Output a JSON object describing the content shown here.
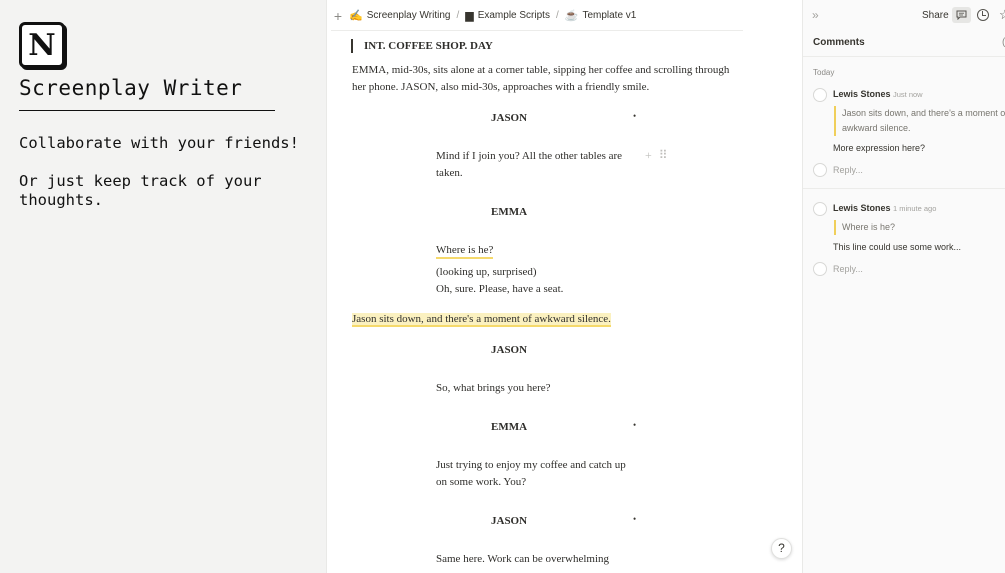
{
  "promo": {
    "title": "Screenplay Writer",
    "paragraph1": "Collaborate with your friends!",
    "paragraph2": "Or just keep track of your thoughts.",
    "logo_letter": "N"
  },
  "topbar": {
    "breadcrumbs": [
      {
        "icon": "✍",
        "label": "Screenplay Writing"
      },
      {
        "icon": "▆",
        "label": "Example Scripts"
      },
      {
        "icon": "☕",
        "label": "Template v1"
      }
    ]
  },
  "screenplay": {
    "scene_heading": "INT.  COFFEE SHOP.  DAY",
    "action1_line1": "EMMA, mid-30s, sits alone at a corner table, sipping her coffee and scrolling through",
    "action1_line2": "her phone. JASON, also mid-30s, approaches with a friendly smile.",
    "char1": "JASON",
    "dlg1_line1": "Mind if I join you? All the other tables are",
    "dlg1_line2": "taken.",
    "char2": "EMMA",
    "dlg2": "Where is he?",
    "paren": "(looking up, surprised)",
    "dlg3": "Oh, sure. Please, have a seat.",
    "action2": "Jason sits down, and there's a moment of awkward silence.",
    "char3": "JASON",
    "dlg4": "So, what brings you here?",
    "char4": "EMMA",
    "dlg5_line1": "Just trying to enjoy my coffee and catch up",
    "dlg5_line2": "on some work. You?",
    "char5": "JASON",
    "dlg6": "Same here. Work can be overwhelming",
    "dot": "•",
    "drag": "+ ⠿"
  },
  "help": "?",
  "panel": {
    "share": "Share",
    "title": "Comments",
    "title_cut": "(",
    "today": "Today",
    "threads": [
      {
        "author": "Lewis Stones",
        "time": "Just now",
        "quote_line1": "Jason sits down, and there's a moment o",
        "quote_line2": "awkward silence.",
        "body": "More expression here?",
        "reply": "Reply..."
      },
      {
        "author": "Lewis Stones",
        "time": "1 minute ago",
        "quote_line1": "Where is he?",
        "body": "This line could use some work...",
        "reply": "Reply..."
      }
    ]
  },
  "colors": {
    "highlight": "#fbf1c0",
    "underline": "#f5d96b",
    "panel_bg": "#fafafa",
    "promo_bg": "#f3f3f2"
  }
}
